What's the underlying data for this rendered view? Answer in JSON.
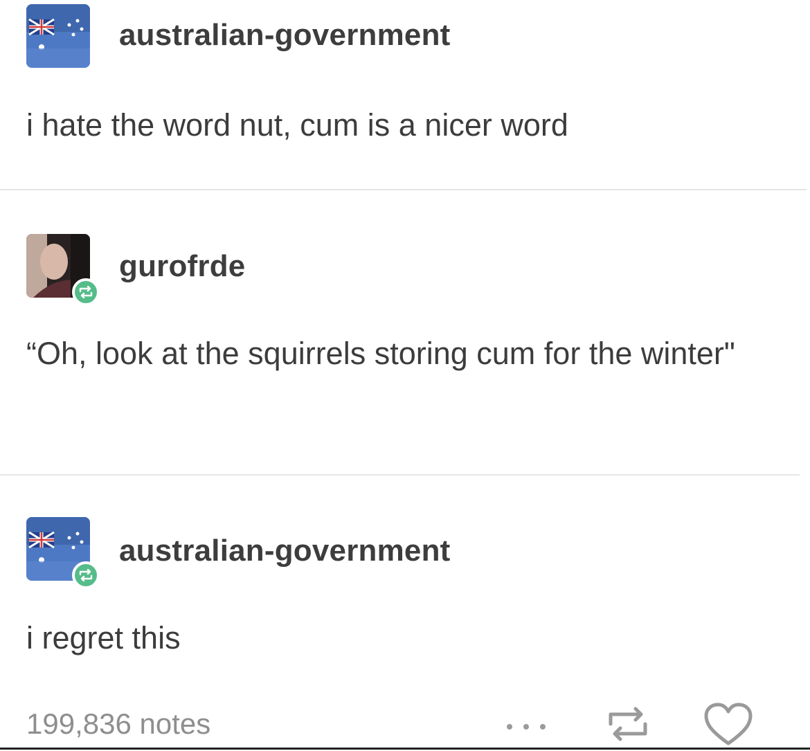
{
  "thread": [
    {
      "username": "australian-government",
      "avatar_icon": "australian-flag-avatar",
      "reblogged": false,
      "text": "i hate the word nut, cum is a nicer word"
    },
    {
      "username": "gurofrde",
      "avatar_icon": "person-photo-avatar",
      "reblogged": true,
      "text": "“Oh, look at the squirrels storing cum for the winter\""
    },
    {
      "username": "australian-government",
      "avatar_icon": "australian-flag-avatar",
      "reblogged": true,
      "text": "i regret this"
    }
  ],
  "footer": {
    "notes": "199,836 notes",
    "actions": [
      "more-icon",
      "reblog-icon",
      "like-icon"
    ]
  },
  "colors": {
    "reblog_badge": "#56bc8a",
    "text": "#3c3c3c",
    "muted": "#8e8e8e",
    "divider": "#e6e6e6"
  }
}
